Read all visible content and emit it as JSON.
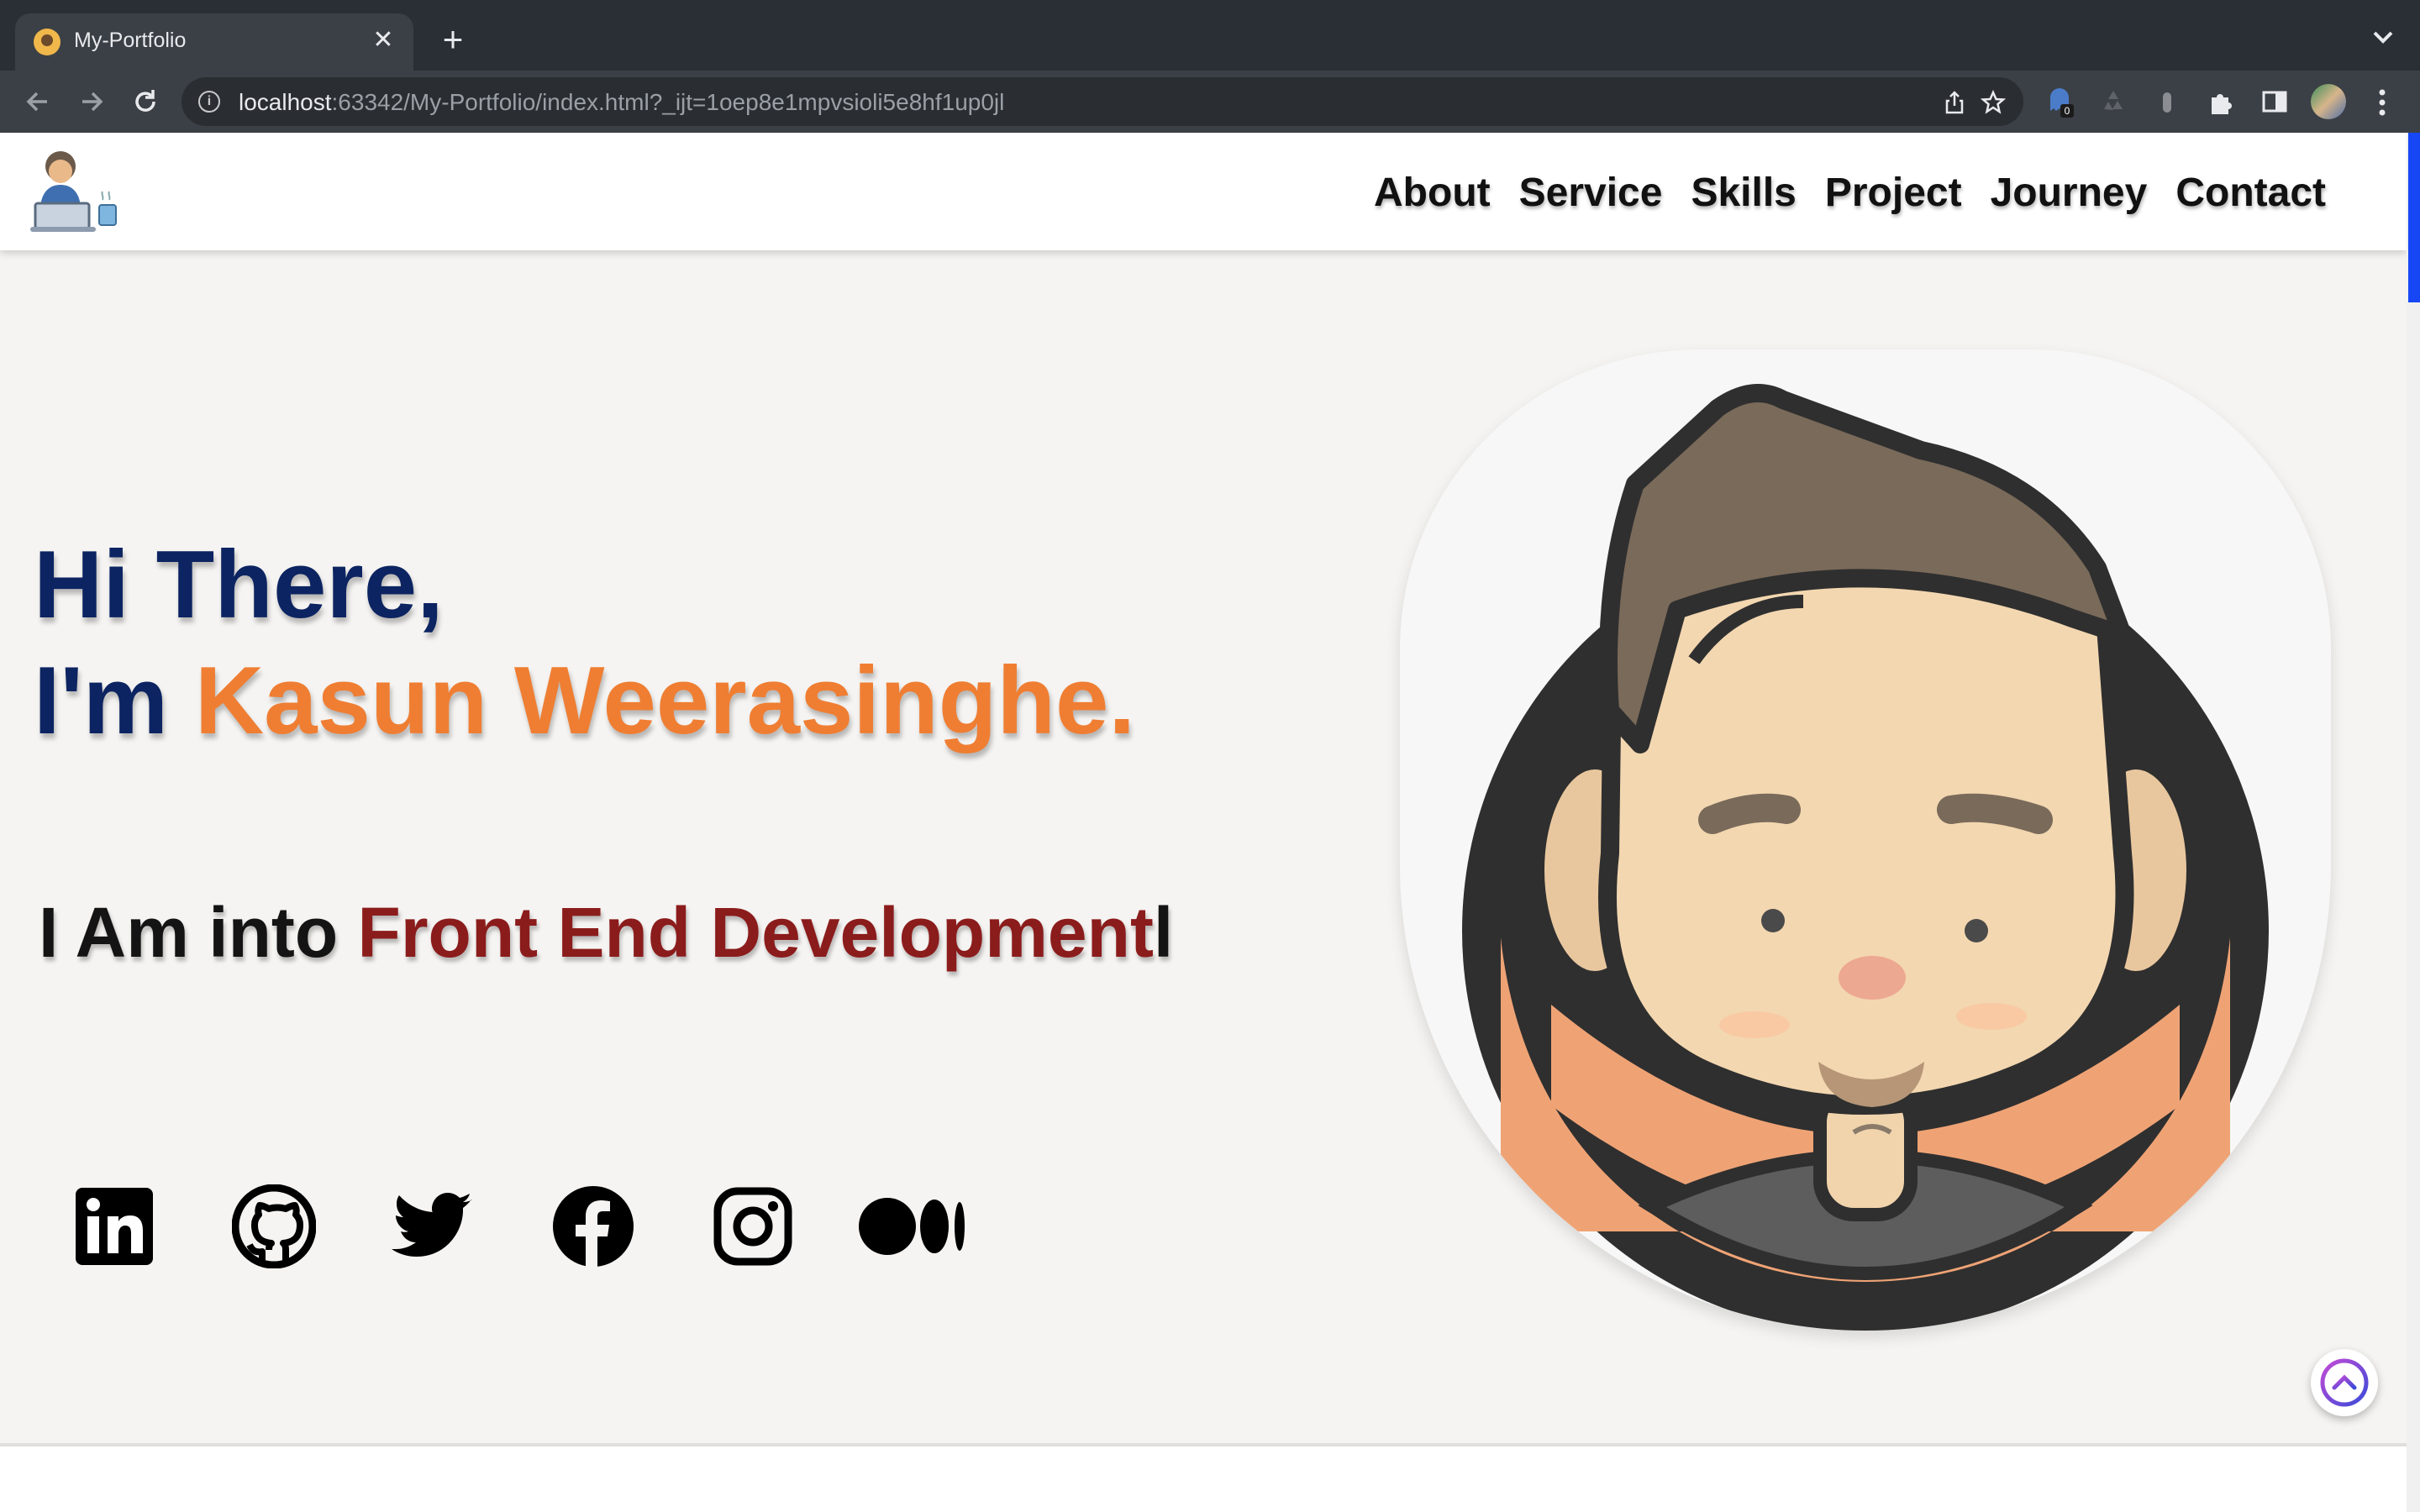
{
  "browser": {
    "tab_title": "My-Portfolio",
    "url_host": "localhost",
    "url_rest": ":63342/My-Portfolio/index.html?_ijt=1oep8e1mpvsioli5e8hf1up0jl",
    "extension_badge": "0"
  },
  "nav": {
    "items": [
      "About",
      "Service",
      "Skills",
      "Project",
      "Journey",
      "Contact"
    ]
  },
  "hero": {
    "greeting": "Hi There,",
    "im": "I'm ",
    "name": "Kasun Weerasinghe.",
    "role_prefix": "I Am into ",
    "role": "Front End Development",
    "cursor": "l"
  },
  "socials": [
    "linkedin",
    "github",
    "twitter",
    "facebook",
    "instagram",
    "medium"
  ],
  "colors": {
    "greeting": "#0c2461",
    "name": "#ef7e33",
    "role": "#8b1c1c",
    "scroll_thumb": "#1747f5"
  }
}
